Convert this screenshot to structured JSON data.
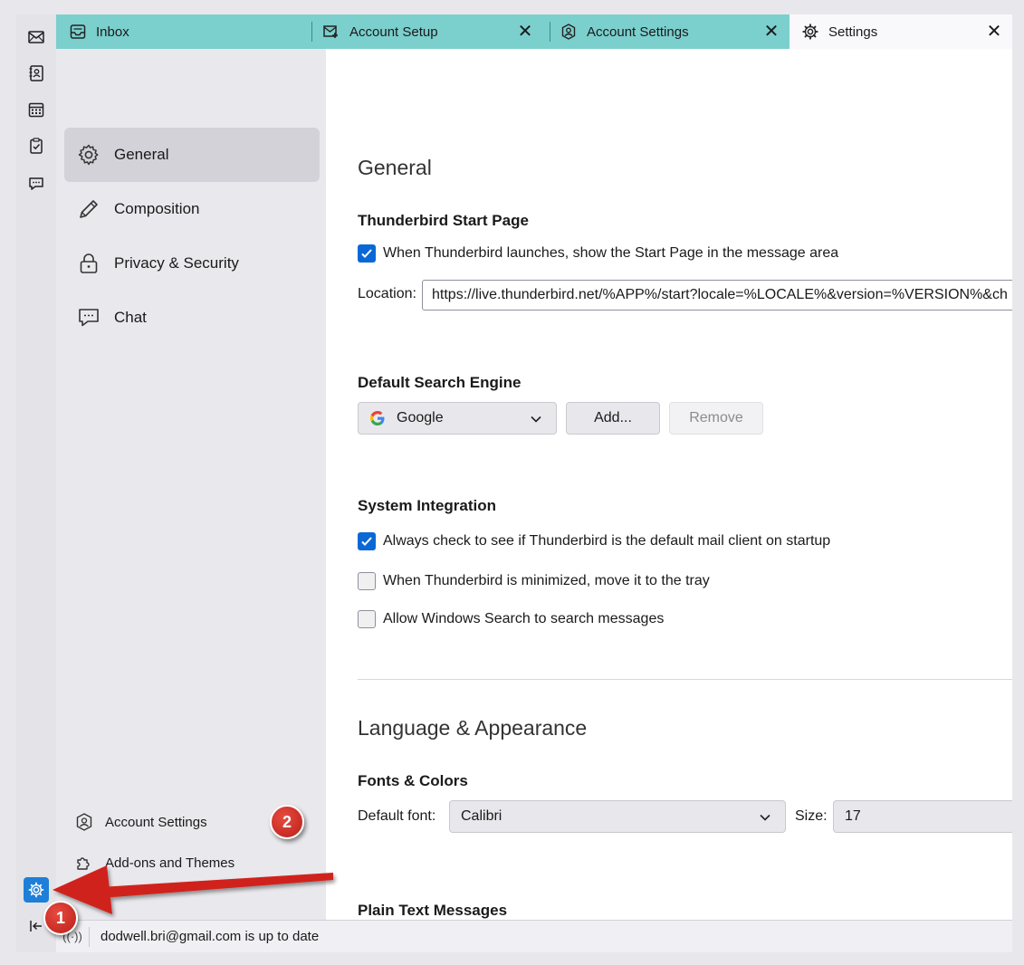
{
  "tabs": [
    {
      "label": "Inbox",
      "icon": "inbox-icon",
      "closable": false
    },
    {
      "label": "Account Setup",
      "icon": "mail-setup-icon",
      "closable": true
    },
    {
      "label": "Account Settings",
      "icon": "account-icon",
      "closable": true
    },
    {
      "label": "Settings",
      "icon": "gear-icon",
      "closable": true,
      "selected": true
    }
  ],
  "close_glyph": "✕",
  "categories": [
    {
      "label": "General",
      "icon": "gear-icon",
      "selected": true
    },
    {
      "label": "Composition",
      "icon": "pencil-icon"
    },
    {
      "label": "Privacy & Security",
      "icon": "lock-icon"
    },
    {
      "label": "Chat",
      "icon": "chat-icon"
    }
  ],
  "sidebar_footer": {
    "account_settings": "Account Settings",
    "addons": "Add-ons and Themes"
  },
  "general": {
    "heading": "General",
    "start_page": {
      "title": "Thunderbird Start Page",
      "checkbox_label": "When Thunderbird launches, show the Start Page in the message area",
      "checked": true,
      "location_label": "Location:",
      "location_value": "https://live.thunderbird.net/%APP%/start?locale=%LOCALE%&version=%VERSION%&ch"
    },
    "search": {
      "title": "Default Search Engine",
      "engine": "Google",
      "add_label": "Add...",
      "remove_label": "Remove"
    },
    "system": {
      "title": "System Integration",
      "default_client": "Always check to see if Thunderbird is the default mail client on startup",
      "default_client_checked": true,
      "tray": "When Thunderbird is minimized, move it to the tray",
      "tray_checked": false,
      "windows_search": "Allow Windows Search to search messages",
      "windows_search_checked": false
    }
  },
  "language": {
    "heading": "Language & Appearance",
    "fonts_title": "Fonts & Colors",
    "default_font_label": "Default font:",
    "default_font_value": "Calibri",
    "size_label": "Size:",
    "size_value": "17",
    "plain_text_title": "Plain Text Messages"
  },
  "status": {
    "message": "dodwell.bri@gmail.com is up to date"
  },
  "annotations": {
    "badge1": "1",
    "badge2": "2",
    "arrow_color": "#d0231c"
  },
  "colors": {
    "tabbar": "#7bcfcd",
    "accent": "#0a68d6",
    "settings_button": "#1e7fd8"
  }
}
